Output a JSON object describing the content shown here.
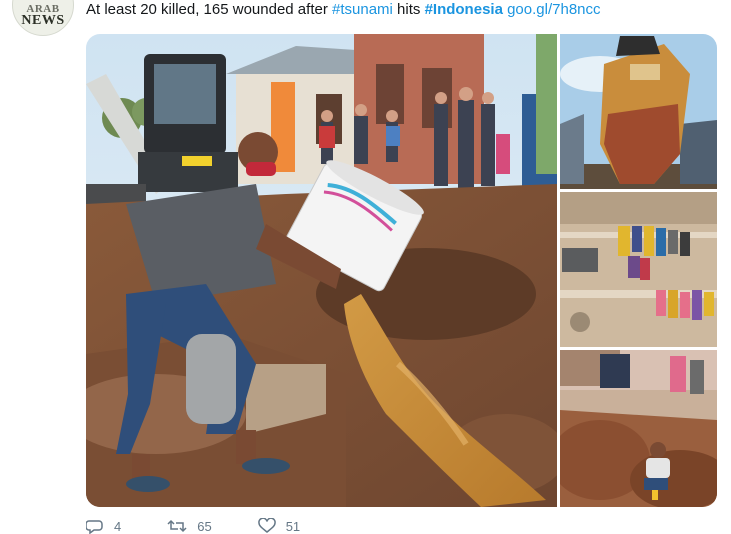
{
  "account": {
    "avatar_line1": "ARAB",
    "avatar_line2": "NEWS"
  },
  "tweet": {
    "text_prefix": "At least 20 killed, 165 wounded after ",
    "hashtag_tsunami": "#tsunami",
    "text_middle": " hits ",
    "hashtag_indonesia": "#Indonesia",
    "text_space": " ",
    "link": "goo.gl/7h8ncc"
  },
  "media": {
    "photos": [
      {
        "icon": "photo-main",
        "description_icon": "man-pouring-bucket"
      },
      {
        "icon": "photo-ship"
      },
      {
        "icon": "photo-fabric"
      },
      {
        "icon": "photo-dig"
      }
    ]
  },
  "actions": {
    "reply_count": "4",
    "retweet_count": "65",
    "like_count": "51"
  },
  "colors": {
    "link": "#1b95e0",
    "text": "#14171a",
    "muted": "#657786"
  }
}
